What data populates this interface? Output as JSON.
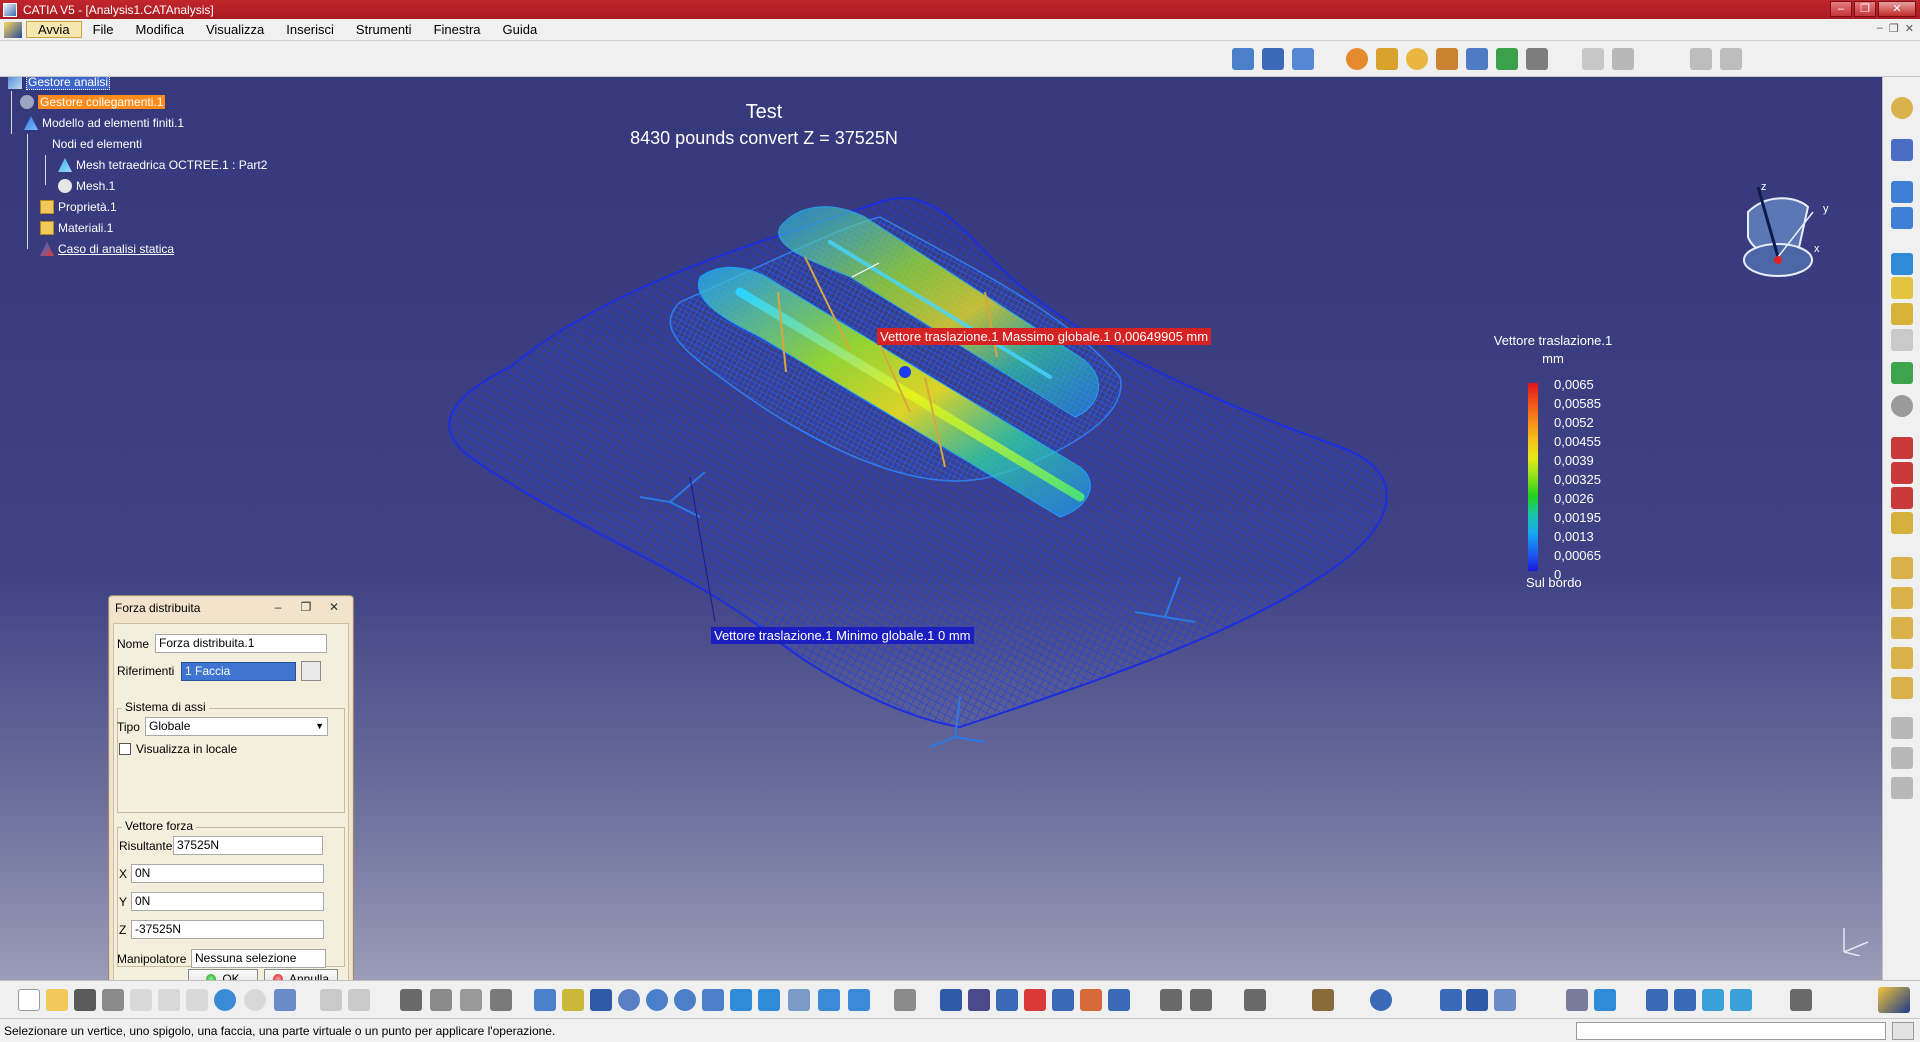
{
  "window": {
    "title": "CATIA V5 - [Analysis1.CATAnalysis]",
    "minimize_glyph": "–",
    "restore_glyph": "❐",
    "close_glyph": "✕"
  },
  "menu": {
    "items": [
      "Avvia",
      "File",
      "Modifica",
      "Visualizza",
      "Inserisci",
      "Strumenti",
      "Finestra",
      "Guida"
    ]
  },
  "tree": {
    "nodes": [
      {
        "label": "Gestore analisi",
        "icon": "analysis-manager-icon"
      },
      {
        "label": "Gestore collegamenti.1",
        "icon": "links-manager-icon"
      },
      {
        "label": "Modello ad elementi finiti.1",
        "icon": "finite-element-model-icon"
      },
      {
        "label": "Nodi ed elementi",
        "icon": "nodes-elements-icon"
      },
      {
        "label": "Mesh tetraedrica OCTREE.1 : Part2",
        "icon": "tetra-mesh-icon"
      },
      {
        "label": "Mesh.1",
        "icon": "mesh-icon"
      },
      {
        "label": "Proprietà.1",
        "icon": "folder-icon"
      },
      {
        "label": "Materiali.1",
        "icon": "folder-icon"
      },
      {
        "label": "Caso di analisi statica",
        "icon": "static-case-icon"
      }
    ]
  },
  "viewport": {
    "title": "Test",
    "subtitle": "8430 pounds convert Z = 37525N"
  },
  "callouts": {
    "max": "Vettore traslazione.1  Massimo globale.1  0,00649905 mm",
    "min": "Vettore traslazione.1  Minimo globale.1  0 mm"
  },
  "legend": {
    "title": "Vettore traslazione.1",
    "unit": "mm",
    "values": [
      "0,0065",
      "0,00585",
      "0,0052",
      "0,00455",
      "0,0039",
      "0,00325",
      "0,0026",
      "0,00195",
      "0,0013",
      "0,00065",
      "0"
    ],
    "colors": [
      "#e0141c",
      "#f0501c",
      "#f58a1a",
      "#f7c01a",
      "#e6ea18",
      "#8ee21a",
      "#22d21a",
      "#18c6a8",
      "#1aa6f2",
      "#1a62f0",
      "#1a1ae0"
    ],
    "footer": "Sul bordo"
  },
  "compass": {
    "y": "y",
    "x": "x",
    "z": "z"
  },
  "dialog": {
    "title": "Forza distribuita",
    "nome_label": "Nome",
    "nome_value": "Forza distribuita.1",
    "riferimenti_label": "Riferimenti",
    "riferimenti_value": "1 Faccia",
    "axis_group": "Sistema di assi",
    "tipo_label": "Tipo",
    "tipo_value": "Globale",
    "local_checkbox": "Visualizza in locale",
    "force_group": "Vettore forza",
    "risultante_label": "Risultante",
    "risultante_value": "37525N",
    "x_label": "X",
    "x_value": "0N",
    "y_label": "Y",
    "y_value": "0N",
    "z_label": "Z",
    "z_value": "-37525N",
    "manip_label": "Manipolatore",
    "manip_value": "Nessuna selezione",
    "ok": "OK",
    "cancel": "Annulla"
  },
  "status": {
    "message": "Selezionare un vertice, uno spigolo, una faccia, una parte virtuale o un punto per applicare l'operazione."
  }
}
